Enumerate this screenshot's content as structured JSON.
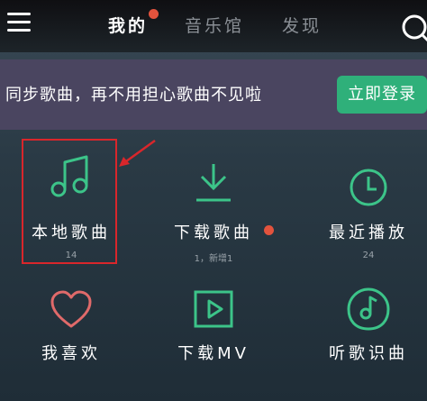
{
  "header": {
    "tabs": [
      {
        "label": "我的",
        "active": true
      },
      {
        "label": "音乐馆",
        "active": false
      },
      {
        "label": "发现",
        "active": false
      }
    ]
  },
  "banner": {
    "text": "同步歌曲，再不用担心歌曲不见啦",
    "login_label": "立即登录"
  },
  "grid": [
    {
      "label": "本地歌曲",
      "sub": "14",
      "icon": "music-note-icon"
    },
    {
      "label": "下载歌曲",
      "sub": "1，新增1",
      "icon": "download-icon"
    },
    {
      "label": "最近播放",
      "sub": "24",
      "icon": "clock-icon"
    },
    {
      "label": "我喜欢",
      "sub": "",
      "icon": "heart-icon"
    },
    {
      "label": "下载MV",
      "sub": "",
      "icon": "play-video-icon"
    },
    {
      "label": "听歌识曲",
      "sub": "",
      "icon": "music-recognition-icon"
    }
  ],
  "colors": {
    "accent_green": "#2fb07a",
    "notification_red": "#e3533d",
    "highlight_red": "#d9262b"
  }
}
